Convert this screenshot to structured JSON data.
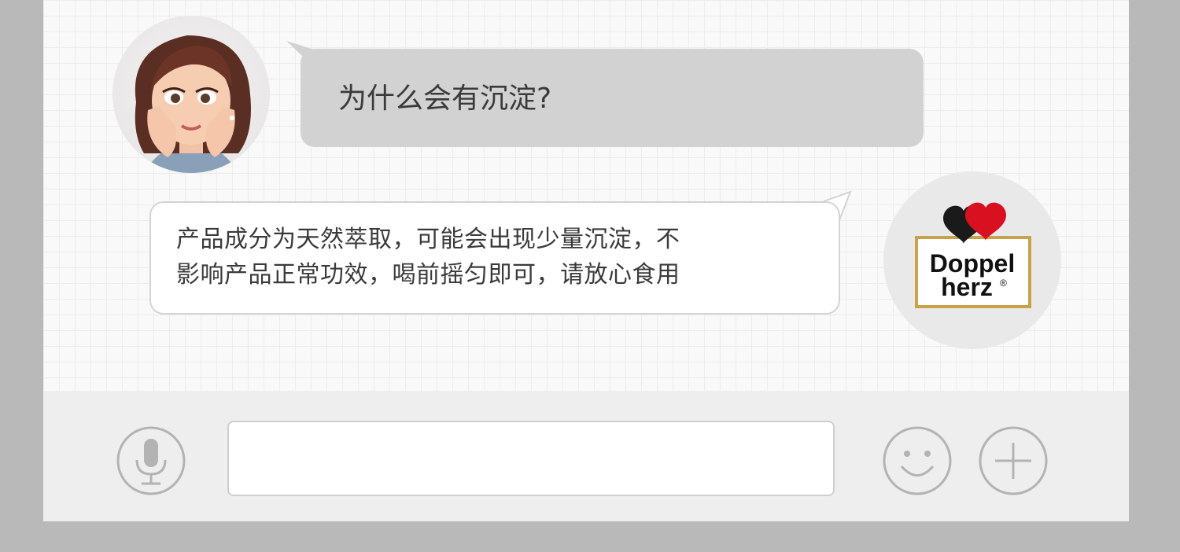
{
  "chat": {
    "messages": [
      {
        "sender": "user",
        "text": "为什么会有沉淀?"
      },
      {
        "sender": "brand",
        "lines": [
          "产品成分为天然萃取，可能会出现少量沉淀，不",
          "影响产品正常功效，喝前摇匀即可，请放心食用"
        ]
      }
    ],
    "brand_logo": {
      "line1": "Doppel",
      "line2": "herz",
      "mark": "®"
    }
  },
  "input_bar": {
    "text_value": "",
    "icons": [
      "microphone-icon",
      "emoji-icon",
      "plus-icon"
    ]
  },
  "colors": {
    "incoming_bubble": "#d2d2d2",
    "outgoing_bubble": "#ffffff",
    "icon_gray": "#b3b3b3",
    "heart_black": "#1a1a1a",
    "heart_red": "#d9101f",
    "logo_gold": "#c8a24a"
  }
}
